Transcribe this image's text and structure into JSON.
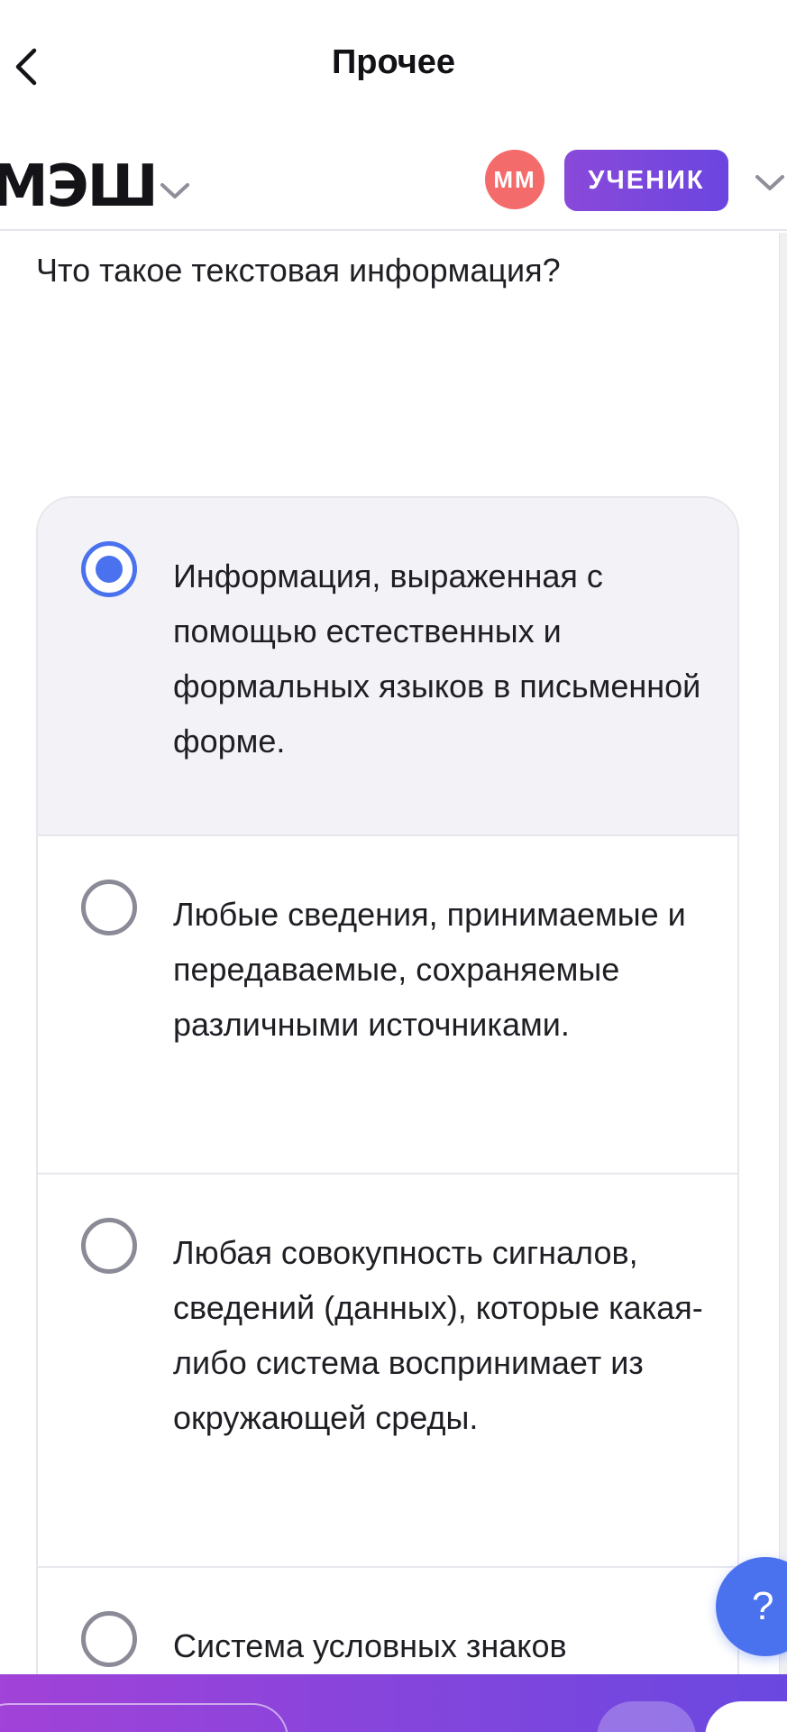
{
  "nav": {
    "title": "Прочее"
  },
  "header": {
    "logo_text": "МЭШ",
    "avatar_initials": "ММ",
    "role_label": "УЧЕНИК"
  },
  "question": {
    "text": "Что такое текстовая информация?"
  },
  "options": [
    {
      "text": "Информация, выраженная с помощью естественных и формальных языков в письменной форме.",
      "selected": true
    },
    {
      "text": "Любые сведения, принимаемые и передаваемые, сохраняемые различными источниками.",
      "selected": false
    },
    {
      "text": "Любая совокупность сигналов, сведений (данных), которые какая-либо система воспринимает из окружающей среды.",
      "selected": false
    },
    {
      "text": "Система условных знаков",
      "selected": false
    }
  ],
  "help": {
    "label": "?"
  },
  "colors": {
    "accent_blue": "#4b72ee",
    "avatar_red": "#f46b6b",
    "role_purple": "#7a47dd"
  },
  "icons": {
    "back": "chevron-left-icon",
    "logo_menu": "chevron-down-icon",
    "profile_menu": "chevron-down-icon"
  }
}
